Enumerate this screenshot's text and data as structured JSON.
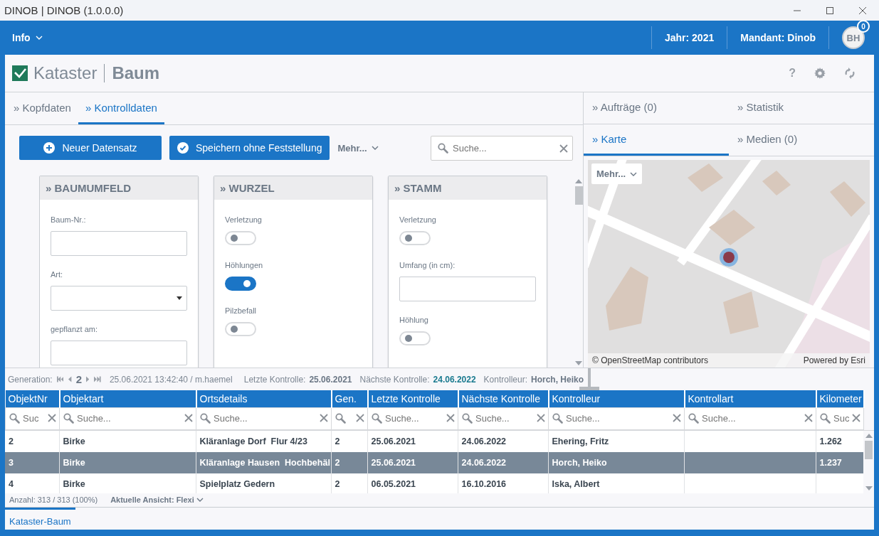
{
  "window": {
    "title": "DINOB | DINOB (1.0.0.0)"
  },
  "app_bar": {
    "menu": "Info",
    "year": "Jahr: 2021",
    "client": "Mandant: Dinob",
    "avatar": "BH",
    "notifications": "0"
  },
  "module": {
    "title": "Kataster",
    "subtitle": "Baum",
    "help": "?"
  },
  "main_tabs": [
    {
      "label": "» Kopfdaten",
      "selected": false
    },
    {
      "label": "» Kontrolldaten",
      "selected": true
    }
  ],
  "toolbar": {
    "buttons": [
      {
        "label": "Neuer Datensatz"
      },
      {
        "label": "Speichern ohne Feststellung"
      }
    ],
    "more": "Mehr...",
    "search": {
      "placeholder": "Suche..."
    }
  },
  "cards": [
    {
      "title": "» BAUMUMFELD",
      "fields": [
        {
          "kind": "text",
          "label": "Baum-Nr.:"
        },
        {
          "kind": "select",
          "label": "Art:"
        },
        {
          "kind": "text",
          "label": "gepflanzt am:"
        }
      ]
    },
    {
      "title": "» WURZEL",
      "fields": [
        {
          "kind": "toggle",
          "label": "Verletzung",
          "on": false
        },
        {
          "kind": "toggle",
          "label": "Höhlungen",
          "on": true
        },
        {
          "kind": "toggle",
          "label": "Pilzbefall",
          "on": false
        }
      ]
    },
    {
      "title": "» STAMM",
      "fields": [
        {
          "kind": "toggle",
          "label": "Verletzung",
          "on": false
        },
        {
          "kind": "text",
          "label": "Umfang (in cm):"
        },
        {
          "kind": "toggle",
          "label": "Höhlung",
          "on": false
        }
      ]
    }
  ],
  "side_tabs_top": [
    {
      "label": "» Aufträge (0)",
      "selected": false
    },
    {
      "label": "» Statistik",
      "selected": false
    }
  ],
  "side_tabs_bottom": [
    {
      "label": "» Karte",
      "selected": true
    },
    {
      "label": "» Medien (0)",
      "selected": false
    }
  ],
  "map": {
    "kind": "picture",
    "more": "Mehr...",
    "attribution": "© OpenStreetMap contributors",
    "powered_by": "Powered by Esri"
  },
  "generation_bar": {
    "label": "Generation:",
    "generation": "2",
    "timestamp": "25.06.2021 13:42:40 / m.haemel",
    "last_check_label": "Letzte Kontrolle:",
    "last_check": "25.06.2021",
    "next_check_label": "Nächste Kontrolle:",
    "next_check": "24.06.2022",
    "inspector_label": "Kontrolleur:",
    "inspector": "Horch, Heiko"
  },
  "table": {
    "columns": [
      {
        "title": "ObjektNr",
        "placeholder": "Suc"
      },
      {
        "title": "Objektart",
        "placeholder": "Suche..."
      },
      {
        "title": "Ortsdetails",
        "placeholder": "Suche..."
      },
      {
        "title": "Gen."
      },
      {
        "title": "Letzte Kontrolle",
        "placeholder": "Suche..."
      },
      {
        "title": "Nächste Kontrolle",
        "placeholder": "Suche..."
      },
      {
        "title": "Kontrolleur",
        "placeholder": "Suche..."
      },
      {
        "title": "Kontrollart",
        "placeholder": "Suche..."
      },
      {
        "title": "Kilometer",
        "placeholder": "Suc"
      }
    ],
    "rows": [
      {
        "selected": false,
        "cells": [
          "2",
          "Birke",
          "Kläranlage Dorf  Flur 4/23",
          "2",
          "25.06.2021",
          "24.06.2022",
          "Ehering, Fritz",
          null,
          "1.262"
        ]
      },
      {
        "selected": true,
        "cells": [
          "3",
          "Birke",
          "Kläranlage Hausen  Hochbehäl",
          "2",
          "25.06.2021",
          "24.06.2022",
          "Horch, Heiko",
          null,
          "1.237"
        ]
      },
      {
        "selected": false,
        "cells": [
          "4",
          "Birke",
          "Spielplatz Gedern",
          "2",
          "06.05.2021",
          "16.10.2016",
          "Iska, Albert",
          null,
          null
        ]
      }
    ]
  },
  "footer": {
    "count": "Anzahl: 313 / 313 (100%)",
    "view": "Aktuelle Ansicht: Flexi"
  },
  "bottom_tabs": [
    {
      "label": "Kataster-Baum",
      "selected": true
    }
  ]
}
